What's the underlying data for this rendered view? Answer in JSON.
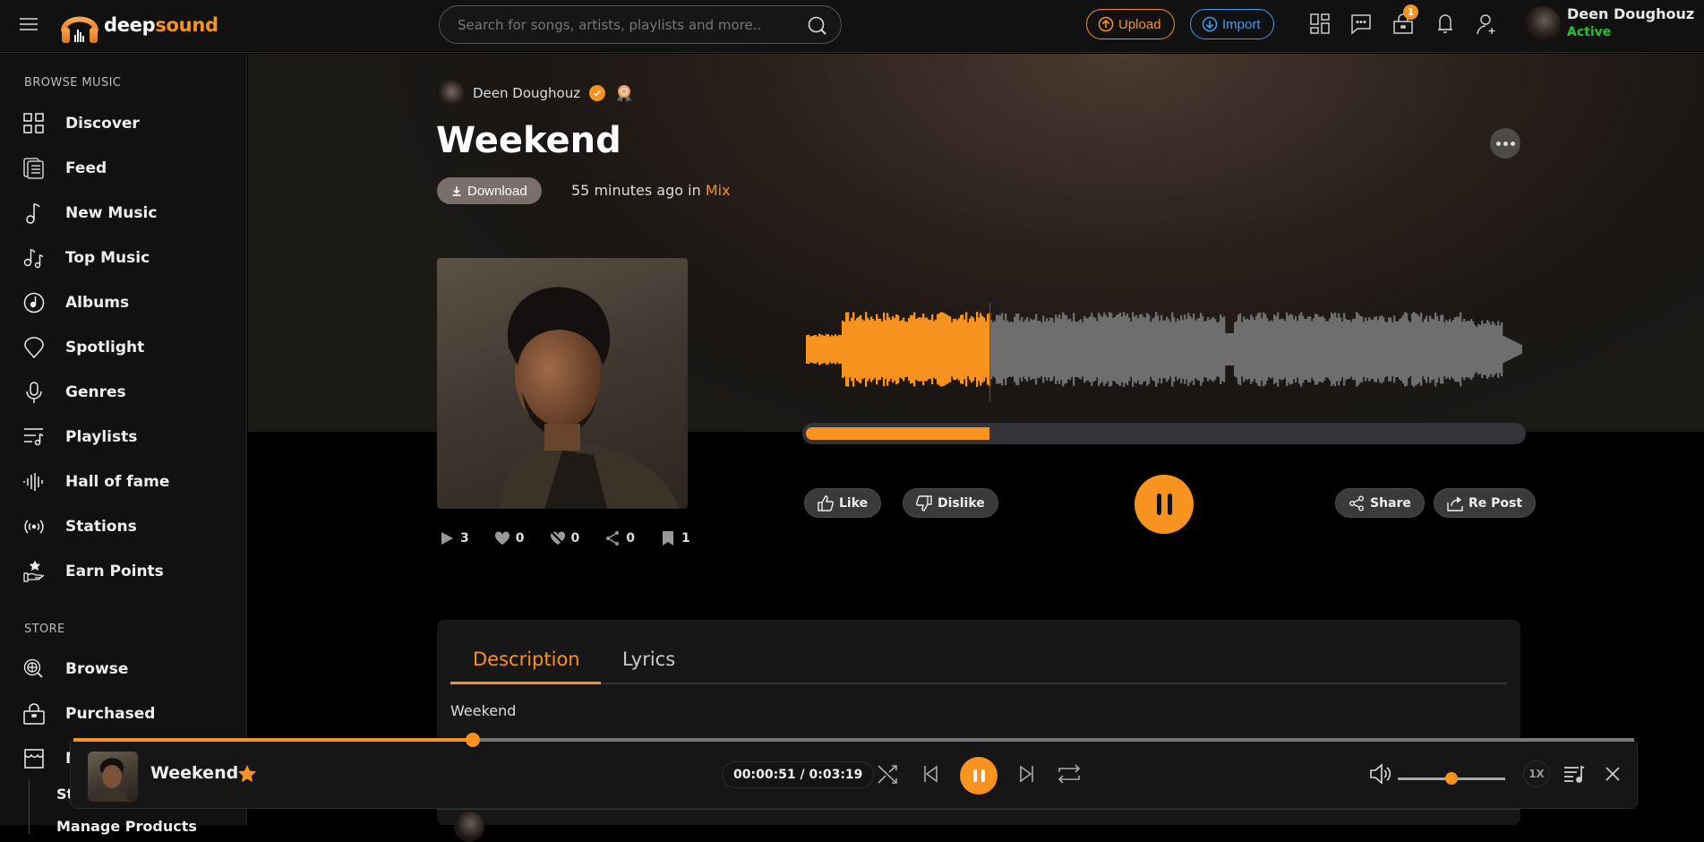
{
  "header": {
    "logo_dark": "deep",
    "logo_accent": "sound",
    "search_placeholder": "Search for songs, artists, playlists and more..",
    "upload_label": "Upload",
    "import_label": "Import",
    "cart_badge": "1",
    "user_name": "Deen Doughouz",
    "user_status": "Active",
    "icons": [
      "grid-icon",
      "messages-icon",
      "cart-icon",
      "bell-icon",
      "add-user-icon"
    ]
  },
  "sidebar": {
    "browse_title": "BROWSE MUSIC",
    "browse_items": [
      {
        "label": "Discover",
        "icon": "grid-icon"
      },
      {
        "label": "Feed",
        "icon": "feed-icon"
      },
      {
        "label": "New Music",
        "icon": "music-note-icon"
      },
      {
        "label": "Top Music",
        "icon": "double-note-icon"
      },
      {
        "label": "Albums",
        "icon": "album-icon"
      },
      {
        "label": "Spotlight",
        "icon": "spotlight-icon"
      },
      {
        "label": "Genres",
        "icon": "microphone-icon"
      },
      {
        "label": "Playlists",
        "icon": "playlist-icon"
      },
      {
        "label": "Hall of fame",
        "icon": "soundwave-icon"
      },
      {
        "label": "Stations",
        "icon": "radio-icon"
      },
      {
        "label": "Earn Points",
        "icon": "hand-star-icon"
      }
    ],
    "store_title": "STORE",
    "store_items": [
      {
        "label": "Browse",
        "icon": "globe-search-icon"
      },
      {
        "label": "Purchased",
        "icon": "bag-icon"
      },
      {
        "label": "My Store",
        "icon": "store-icon"
      }
    ],
    "store_sub_items": [
      "Store",
      "Manage Products"
    ]
  },
  "track": {
    "artist": "Deen Doughouz",
    "title": "Weekend",
    "download_label": "Download",
    "time_ago": "55 minutes ago in ",
    "category": "Mix",
    "stats": {
      "plays": "3",
      "likes": "0",
      "dislikes": "0",
      "shares": "0",
      "saves": "1"
    },
    "progress_fraction": 0.256,
    "like_label": "Like",
    "dislike_label": "Dislike",
    "share_label": "Share",
    "repost_label": "Re Post"
  },
  "tabs": {
    "description_label": "Description",
    "lyrics_label": "Lyrics",
    "active": "Description",
    "description_text": "Weekend"
  },
  "player": {
    "title": "Weekend",
    "elapsed": "00:00:51",
    "duration": "0:03:19",
    "time_display": "00:00:51 / 0:03:19",
    "progress_fraction": 0.256,
    "volume_fraction": 0.5,
    "speed": "1X"
  },
  "colors": {
    "accent": "#f7931e",
    "import": "#3a9cf0",
    "active_status": "#22c32e"
  }
}
